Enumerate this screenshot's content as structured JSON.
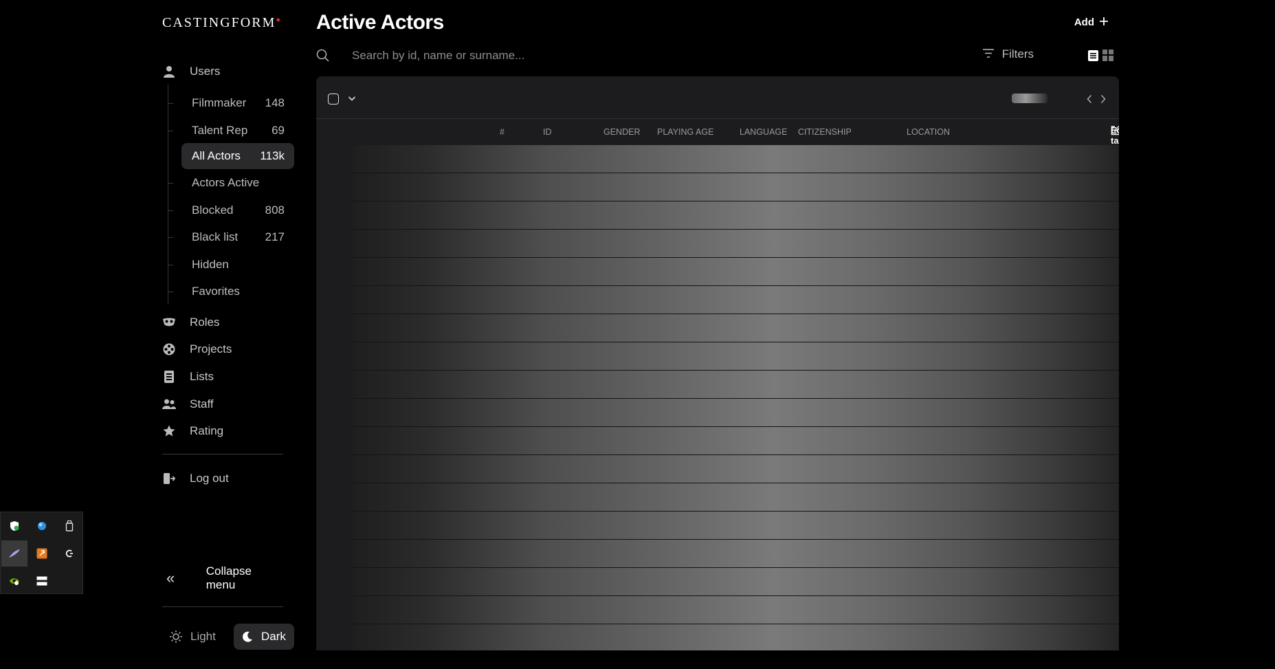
{
  "sidebar": {
    "logo": "CASTINGFORM",
    "users_label": "Users",
    "sub_items": [
      {
        "label": "Filmmaker",
        "count": "148"
      },
      {
        "label": "Talent Rep",
        "count": "69"
      },
      {
        "label": "All Actors",
        "count": "113k",
        "active": true
      },
      {
        "label": "Actors Active",
        "count": ""
      },
      {
        "label": "Blocked",
        "count": "808"
      },
      {
        "label": "Black list",
        "count": "217"
      },
      {
        "label": "Hidden",
        "count": ""
      },
      {
        "label": "Favorites",
        "count": ""
      }
    ],
    "roles_label": "Roles",
    "projects_label": "Projects",
    "lists_label": "Lists",
    "staff_label": "Staff",
    "rating_label": "Rating",
    "logout_label": "Log out",
    "collapse_label": "Collapse menu",
    "theme": {
      "light": "Light",
      "dark": "Dark",
      "selected": "Dark"
    }
  },
  "main": {
    "title": "Active Actors",
    "add_label": "Add",
    "search": {
      "placeholder": "Search by id, name or surname...",
      "value": ""
    },
    "filters_label": "Filters",
    "table": {
      "columns": [
        "#",
        "ID",
        "GENDER",
        "PLAYING AGE",
        "LANGUAGE",
        "CITIZENSHIP",
        "LOCATION"
      ],
      "edit_label": "Edit table"
    }
  },
  "colors": {
    "background": "#000000",
    "panel": "#1c1c1e",
    "active_item": "#2a2a2c",
    "logo_dot": "#e0283c"
  }
}
